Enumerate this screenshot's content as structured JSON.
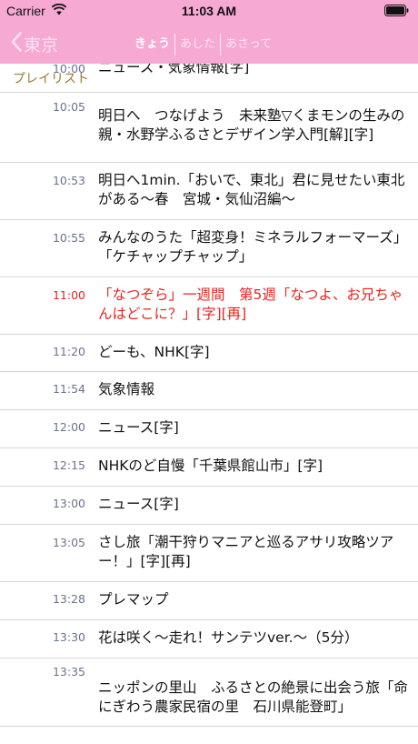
{
  "status_bar": {
    "carrier": "Carrier",
    "time": "11:03 AM"
  },
  "nav": {
    "back_label": "東京",
    "tabs": [
      {
        "label": "きょう",
        "active": true
      },
      {
        "label": "あした",
        "active": false
      },
      {
        "label": "あさって",
        "active": false
      }
    ],
    "playlist_label": "プレイリスト"
  },
  "colors": {
    "header_bg": "#f5a9d3",
    "highlight_text": "#e8231f",
    "time_text": "#6a7290",
    "playlist_text": "#9a7b35"
  },
  "programs": [
    {
      "time": "10:00",
      "title": "ニュース・気象情報[字]"
    },
    {
      "time": "10:05",
      "title": "明日へ　つなげよう　未来塾▽くまモンの生みの親・水野学ふるさとデザイン学入門[解][字]"
    },
    {
      "time": "10:53",
      "title": "明日へ1min.「おいで、東北」君に見せたい東北がある〜春　宮城・気仙沼編〜"
    },
    {
      "time": "10:55",
      "title": "みんなのうた「超変身！ミネラルフォーマーズ」「ケチャップチャップ」"
    },
    {
      "time": "11:00",
      "title": "「なつぞら」一週間　第5週「なつよ、お兄ちゃんはどこに？」[字][再]",
      "highlight": true
    },
    {
      "time": "11:20",
      "title": "どーも、NHK[字]"
    },
    {
      "time": "11:54",
      "title": "気象情報"
    },
    {
      "time": "12:00",
      "title": "ニュース[字]"
    },
    {
      "time": "12:15",
      "title": "NHKのど自慢「千葉県館山市」[字]"
    },
    {
      "time": "13:00",
      "title": "ニュース[字]"
    },
    {
      "time": "13:05",
      "title": "さし旅「潮干狩りマニアと巡るアサリ攻略ツアー！」[字][再]"
    },
    {
      "time": "13:28",
      "title": "プレマップ"
    },
    {
      "time": "13:30",
      "title": "花は咲く〜走れ！サンテツver.〜（5分）"
    },
    {
      "time": "13:35",
      "title": "ニッポンの里山　ふるさとの絶景に出会う旅「命にぎわう農家民宿の里　石川県能登町」"
    }
  ]
}
